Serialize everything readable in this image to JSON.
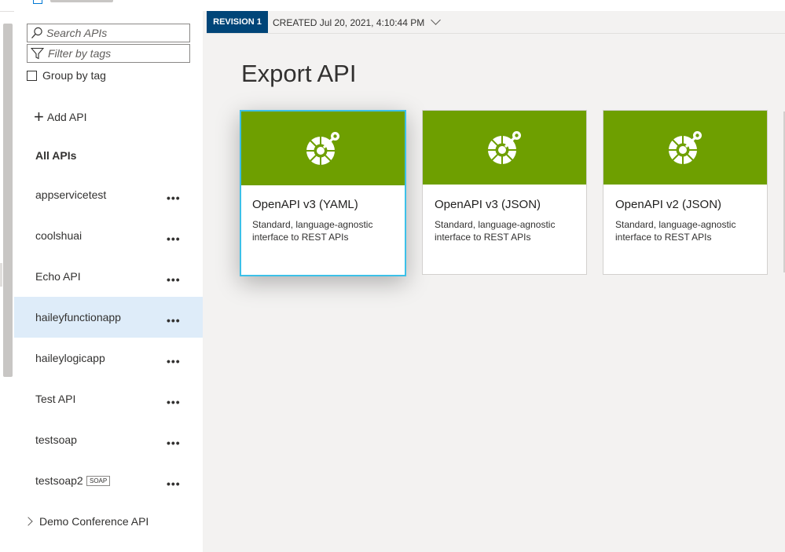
{
  "sidebar": {
    "search_placeholder": "Search APIs",
    "filter_placeholder": "Filter by tags",
    "group_by_label": "Group by tag",
    "group_by_checked": false,
    "add_api_label": "Add API",
    "all_apis_label": "All APIs",
    "apis": [
      {
        "name": "appservicetest",
        "badge": "",
        "selected": false
      },
      {
        "name": "coolshuai",
        "badge": "",
        "selected": false
      },
      {
        "name": "Echo API",
        "badge": "",
        "selected": false
      },
      {
        "name": "haileyfunctionapp",
        "badge": "",
        "selected": true
      },
      {
        "name": "haileylogicapp",
        "badge": "",
        "selected": false
      },
      {
        "name": "Test API",
        "badge": "",
        "selected": false
      },
      {
        "name": "testsoap",
        "badge": "",
        "selected": false
      },
      {
        "name": "testsoap2",
        "badge": "SOAP",
        "selected": false
      }
    ],
    "more_label": "•••",
    "demo_group_label": "Demo Conference API"
  },
  "revision": {
    "tag": "REVISION 1",
    "created": "CREATED Jul 20, 2021, 4:10:44 PM"
  },
  "export": {
    "title": "Export API",
    "cards": [
      {
        "title": "OpenAPI v3 (YAML)",
        "description": "Standard, language-agnostic interface to REST APIs",
        "selected": true,
        "highlighted": false
      },
      {
        "title": "OpenAPI v3 (JSON)",
        "description": "Standard, language-agnostic interface to REST APIs",
        "selected": false,
        "highlighted": true
      },
      {
        "title": "OpenAPI v2 (JSON)",
        "description": "Standard, language-agnostic interface to REST APIs",
        "selected": false,
        "highlighted": false
      }
    ]
  },
  "colors": {
    "card_banner": "#6e9f00",
    "revision_tag": "#004578",
    "selected_row": "#deecf9",
    "selected_card_border": "#3cc0e8",
    "highlight": "#ffee00"
  },
  "icons": {
    "search": "search-icon",
    "filter": "filter-icon",
    "add": "plus-icon",
    "more": "more-icon",
    "expand": "chevron-right-icon",
    "dropdown": "chevron-down-icon",
    "openapi": "openapi-logo-icon"
  }
}
